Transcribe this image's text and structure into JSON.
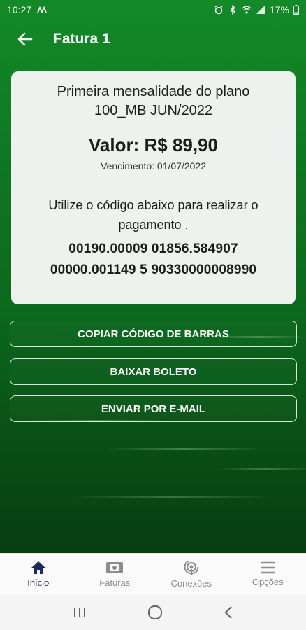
{
  "status_bar": {
    "time": "10:27",
    "battery": "17%"
  },
  "header": {
    "title": "Fatura 1"
  },
  "invoice": {
    "plan": "Primeira mensalidade do plano 100_MB JUN/2022",
    "amount": "Valor: R$ 89,90",
    "due": "Vencimento: 01/07/2022",
    "instructions": "Utilize o código abaixo para realizar o pagamento .",
    "barcode_line1": "00190.00009 01856.584907",
    "barcode_line2": "00000.001149 5 90330000008990"
  },
  "actions": {
    "copy": "COPIAR CÓDIGO DE BARRAS",
    "download": "BAIXAR BOLETO",
    "email": "ENVIAR POR E-MAIL"
  },
  "nav": [
    {
      "label": "Início",
      "icon": "home-icon",
      "active": true
    },
    {
      "label": "Faturas",
      "icon": "bill-icon",
      "active": false
    },
    {
      "label": "Conexões",
      "icon": "connections-icon",
      "active": false
    },
    {
      "label": "Opções",
      "icon": "menu-icon",
      "active": false
    }
  ],
  "colors": {
    "accent": "#0f7a22",
    "nav_active": "#1a2b5c",
    "card_bg": "#eef2ee"
  }
}
